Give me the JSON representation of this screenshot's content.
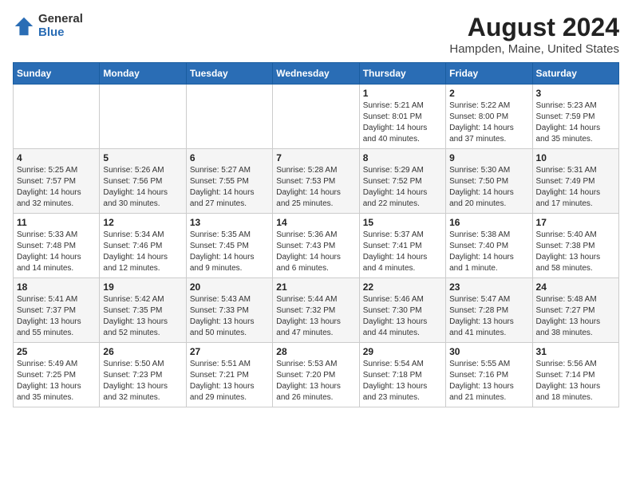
{
  "logo": {
    "general": "General",
    "blue": "Blue"
  },
  "title": "August 2024",
  "subtitle": "Hampden, Maine, United States",
  "weekdays": [
    "Sunday",
    "Monday",
    "Tuesday",
    "Wednesday",
    "Thursday",
    "Friday",
    "Saturday"
  ],
  "weeks": [
    [
      {
        "day": "",
        "info": ""
      },
      {
        "day": "",
        "info": ""
      },
      {
        "day": "",
        "info": ""
      },
      {
        "day": "",
        "info": ""
      },
      {
        "day": "1",
        "info": "Sunrise: 5:21 AM\nSunset: 8:01 PM\nDaylight: 14 hours\nand 40 minutes."
      },
      {
        "day": "2",
        "info": "Sunrise: 5:22 AM\nSunset: 8:00 PM\nDaylight: 14 hours\nand 37 minutes."
      },
      {
        "day": "3",
        "info": "Sunrise: 5:23 AM\nSunset: 7:59 PM\nDaylight: 14 hours\nand 35 minutes."
      }
    ],
    [
      {
        "day": "4",
        "info": "Sunrise: 5:25 AM\nSunset: 7:57 PM\nDaylight: 14 hours\nand 32 minutes."
      },
      {
        "day": "5",
        "info": "Sunrise: 5:26 AM\nSunset: 7:56 PM\nDaylight: 14 hours\nand 30 minutes."
      },
      {
        "day": "6",
        "info": "Sunrise: 5:27 AM\nSunset: 7:55 PM\nDaylight: 14 hours\nand 27 minutes."
      },
      {
        "day": "7",
        "info": "Sunrise: 5:28 AM\nSunset: 7:53 PM\nDaylight: 14 hours\nand 25 minutes."
      },
      {
        "day": "8",
        "info": "Sunrise: 5:29 AM\nSunset: 7:52 PM\nDaylight: 14 hours\nand 22 minutes."
      },
      {
        "day": "9",
        "info": "Sunrise: 5:30 AM\nSunset: 7:50 PM\nDaylight: 14 hours\nand 20 minutes."
      },
      {
        "day": "10",
        "info": "Sunrise: 5:31 AM\nSunset: 7:49 PM\nDaylight: 14 hours\nand 17 minutes."
      }
    ],
    [
      {
        "day": "11",
        "info": "Sunrise: 5:33 AM\nSunset: 7:48 PM\nDaylight: 14 hours\nand 14 minutes."
      },
      {
        "day": "12",
        "info": "Sunrise: 5:34 AM\nSunset: 7:46 PM\nDaylight: 14 hours\nand 12 minutes."
      },
      {
        "day": "13",
        "info": "Sunrise: 5:35 AM\nSunset: 7:45 PM\nDaylight: 14 hours\nand 9 minutes."
      },
      {
        "day": "14",
        "info": "Sunrise: 5:36 AM\nSunset: 7:43 PM\nDaylight: 14 hours\nand 6 minutes."
      },
      {
        "day": "15",
        "info": "Sunrise: 5:37 AM\nSunset: 7:41 PM\nDaylight: 14 hours\nand 4 minutes."
      },
      {
        "day": "16",
        "info": "Sunrise: 5:38 AM\nSunset: 7:40 PM\nDaylight: 14 hours\nand 1 minute."
      },
      {
        "day": "17",
        "info": "Sunrise: 5:40 AM\nSunset: 7:38 PM\nDaylight: 13 hours\nand 58 minutes."
      }
    ],
    [
      {
        "day": "18",
        "info": "Sunrise: 5:41 AM\nSunset: 7:37 PM\nDaylight: 13 hours\nand 55 minutes."
      },
      {
        "day": "19",
        "info": "Sunrise: 5:42 AM\nSunset: 7:35 PM\nDaylight: 13 hours\nand 52 minutes."
      },
      {
        "day": "20",
        "info": "Sunrise: 5:43 AM\nSunset: 7:33 PM\nDaylight: 13 hours\nand 50 minutes."
      },
      {
        "day": "21",
        "info": "Sunrise: 5:44 AM\nSunset: 7:32 PM\nDaylight: 13 hours\nand 47 minutes."
      },
      {
        "day": "22",
        "info": "Sunrise: 5:46 AM\nSunset: 7:30 PM\nDaylight: 13 hours\nand 44 minutes."
      },
      {
        "day": "23",
        "info": "Sunrise: 5:47 AM\nSunset: 7:28 PM\nDaylight: 13 hours\nand 41 minutes."
      },
      {
        "day": "24",
        "info": "Sunrise: 5:48 AM\nSunset: 7:27 PM\nDaylight: 13 hours\nand 38 minutes."
      }
    ],
    [
      {
        "day": "25",
        "info": "Sunrise: 5:49 AM\nSunset: 7:25 PM\nDaylight: 13 hours\nand 35 minutes."
      },
      {
        "day": "26",
        "info": "Sunrise: 5:50 AM\nSunset: 7:23 PM\nDaylight: 13 hours\nand 32 minutes."
      },
      {
        "day": "27",
        "info": "Sunrise: 5:51 AM\nSunset: 7:21 PM\nDaylight: 13 hours\nand 29 minutes."
      },
      {
        "day": "28",
        "info": "Sunrise: 5:53 AM\nSunset: 7:20 PM\nDaylight: 13 hours\nand 26 minutes."
      },
      {
        "day": "29",
        "info": "Sunrise: 5:54 AM\nSunset: 7:18 PM\nDaylight: 13 hours\nand 23 minutes."
      },
      {
        "day": "30",
        "info": "Sunrise: 5:55 AM\nSunset: 7:16 PM\nDaylight: 13 hours\nand 21 minutes."
      },
      {
        "day": "31",
        "info": "Sunrise: 5:56 AM\nSunset: 7:14 PM\nDaylight: 13 hours\nand 18 minutes."
      }
    ]
  ]
}
